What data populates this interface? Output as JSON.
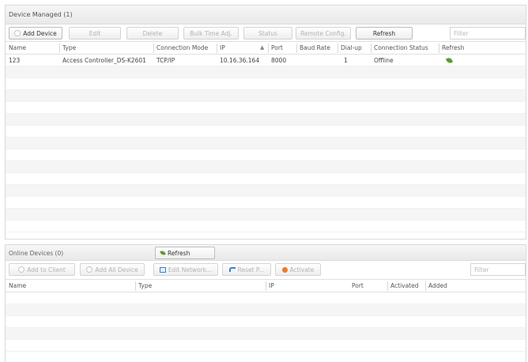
{
  "device_managed": {
    "title": "Device Managed (1)",
    "buttons": {
      "add_device": "Add Device",
      "edit": "Edit",
      "delete": "Delete",
      "bulk_time_adj": "Bulk Time Adj.",
      "status": "Status",
      "remote_config": "Remote Config.",
      "refresh": "Refresh"
    },
    "filter_placeholder": "Filter",
    "columns": [
      "Name",
      "Type",
      "Connection Mode",
      "IP",
      "Port",
      "Baud Rate",
      "Dial-up",
      "Connection Status",
      "Refresh"
    ],
    "rows": [
      {
        "name": "123",
        "type": "Access Controller_DS-K2601",
        "connection_mode": "TCP/IP",
        "ip": "10.16.36.164",
        "port": "8000",
        "baud_rate": "",
        "dial_up": "1",
        "connection_status": "Offline",
        "refresh_icon": "leaf-refresh-icon"
      }
    ]
  },
  "online_devices": {
    "title": "Online Devices (0)",
    "refresh_label": "Refresh",
    "buttons": {
      "add_to_client": "Add to Client",
      "add_all_device": "Add All Device",
      "edit_network": "Edit Network...",
      "reset_password": "Reset P...",
      "activate": "Activate"
    },
    "filter_placeholder": "Filter",
    "columns": [
      "Name",
      "Type",
      "IP",
      "Port",
      "Activated",
      "Added"
    ]
  },
  "colors": {
    "accent_green": "#5a9b32",
    "activate_orange": "#ee7a2a",
    "edit_blue": "#3f7fd0",
    "row_alt": "#f5f5f5"
  }
}
